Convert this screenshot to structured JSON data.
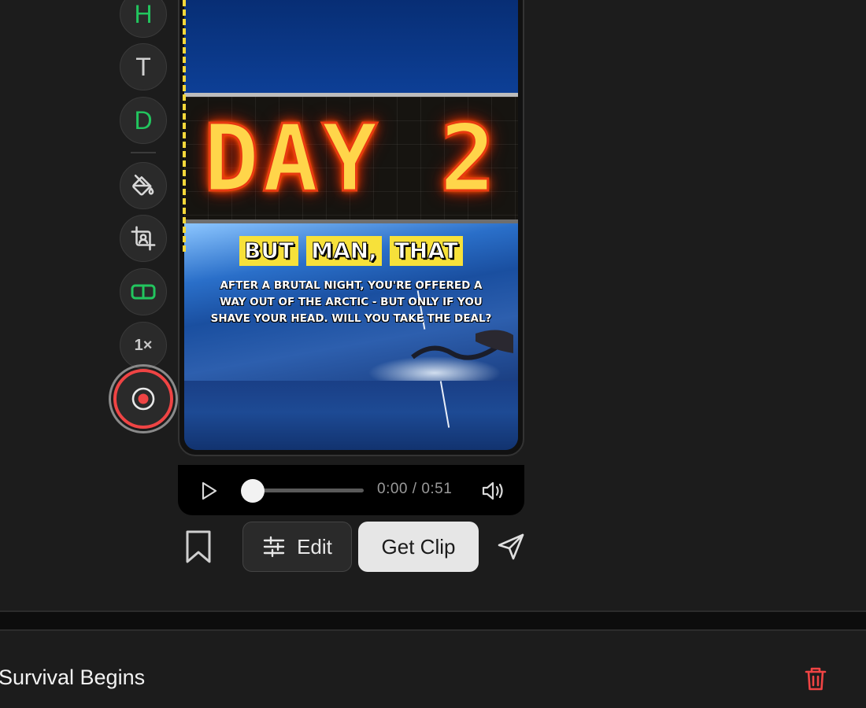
{
  "toolbar": {
    "tools": [
      {
        "name": "heading-tool",
        "glyph": "H",
        "color": "#22c55e"
      },
      {
        "name": "text-tool",
        "glyph": "T",
        "color": "#d0d0d0"
      },
      {
        "name": "d-tool",
        "glyph": "D",
        "color": "#22c55e"
      }
    ],
    "speed_label": "1×",
    "icons": [
      "paint-bucket-icon",
      "crop-icon",
      "layout-split-icon",
      "record-icon"
    ],
    "accent_green": "#22c55e",
    "record_color": "#ef4444"
  },
  "video": {
    "overlay_day": "DAY 2",
    "overlay_words": [
      "BUT",
      "MAN,",
      "THAT"
    ],
    "caption": "AFTER A BRUTAL NIGHT, YOU'RE OFFERED A WAY OUT OF THE ARCTIC - BUT ONLY IF YOU SHAVE YOUR HEAD. WILL YOU TAKE THE DEAL?"
  },
  "player": {
    "time": "0:00 / 0:51",
    "progress": 0
  },
  "actions": {
    "edit_label": "Edit",
    "get_clip_label": "Get Clip"
  },
  "clip": {
    "title": "Survival Begins"
  }
}
